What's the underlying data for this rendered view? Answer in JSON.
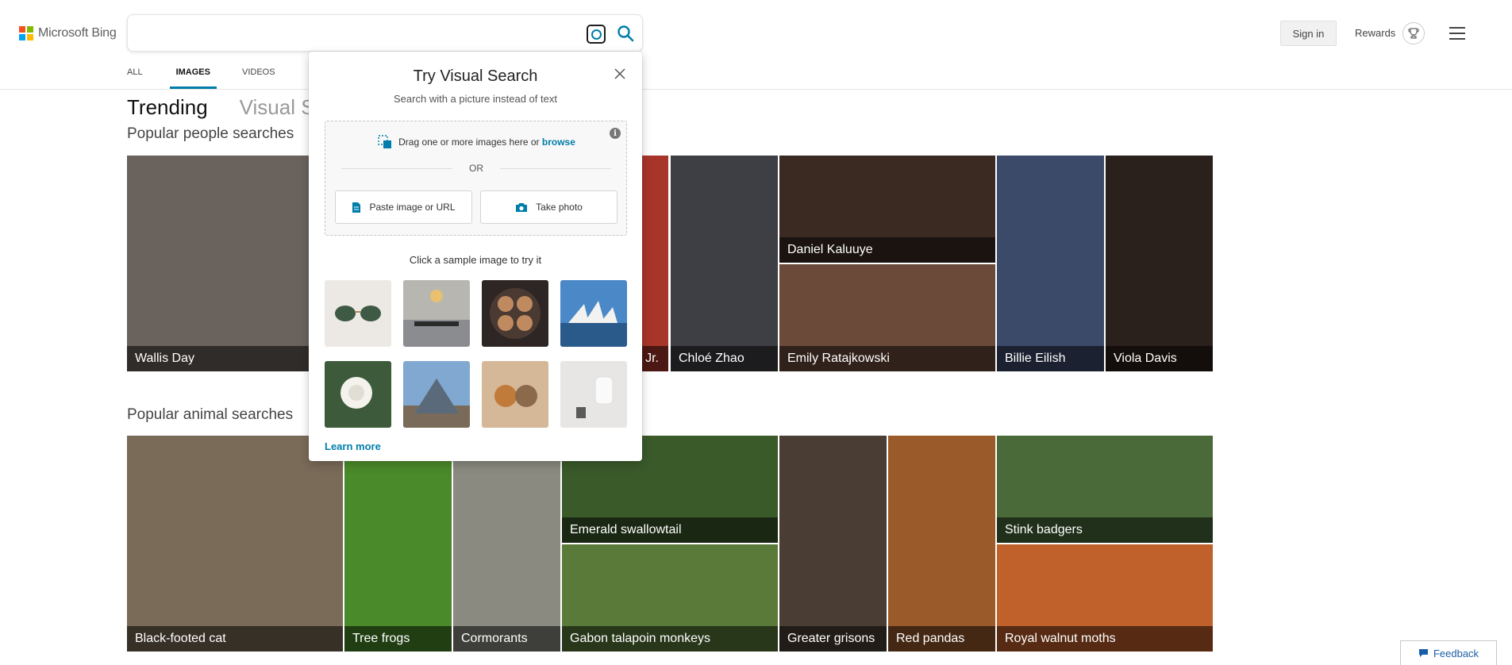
{
  "header": {
    "brand": "Microsoft Bing",
    "search_value": "",
    "signin_label": "Sign in",
    "rewards_label": "Rewards"
  },
  "nav_tabs": [
    "ALL",
    "IMAGES",
    "VIDEOS"
  ],
  "section_tabs": {
    "trending": "Trending",
    "visual": "Visual Se"
  },
  "groups": {
    "people_title": "Popular people searches",
    "animals_title": "Popular animal searches"
  },
  "people": [
    {
      "label": "Wallis Day",
      "color": "#5a5450"
    },
    {
      "label": "Jr.",
      "color": "#a8352a"
    },
    {
      "label": "Chloé Zhao",
      "color": "#3e3f45"
    },
    {
      "label": "Daniel Kaluuye",
      "color": "#3a2a22"
    },
    {
      "label": "Emily Ratajkowski",
      "color": "#6b4a3a"
    },
    {
      "label": "Billie Eilish",
      "color": "#3c4a6a"
    },
    {
      "label": "Viola Davis",
      "color": "#2a201c"
    }
  ],
  "animals": [
    {
      "label": "Black-footed cat",
      "color": "#7a6a58"
    },
    {
      "label": "Tree frogs",
      "color": "#4a8a2a"
    },
    {
      "label": "Cormorants",
      "color": "#8a8a80"
    },
    {
      "label": "Emerald swallowtail",
      "color": "#3a5a2a"
    },
    {
      "label": "Gabon talapoin monkeys",
      "color": "#5a7a3a"
    },
    {
      "label": "Greater grisons",
      "color": "#4a3e34"
    },
    {
      "label": "Red pandas",
      "color": "#9a5a2a"
    },
    {
      "label": "Stink badgers",
      "color": "#4a6a3a"
    },
    {
      "label": "Royal walnut moths",
      "color": "#c0602a"
    }
  ],
  "visual_search": {
    "title": "Try Visual Search",
    "subtitle": "Search with a picture instead of text",
    "drag_text": "Drag one or more images here or",
    "browse_label": "browse",
    "info_glyph": "i",
    "or_label": "OR",
    "paste_label": "Paste image or URL",
    "photo_label": "Take photo",
    "hint": "Click a sample image to try it",
    "learn_more": "Learn more",
    "samples": [
      {
        "icon": "sunglasses-sample",
        "color": "#e8e6e2"
      },
      {
        "icon": "dining-room-sample",
        "color": "#8a8c90"
      },
      {
        "icon": "coffee-cups-sample",
        "color": "#3a2e2a"
      },
      {
        "icon": "opera-house-sample",
        "color": "#3d78b8"
      },
      {
        "icon": "white-rose-sample",
        "color": "#3d5a3a"
      },
      {
        "icon": "louvre-pyramid-sample",
        "color": "#7aa0c8"
      },
      {
        "icon": "puppies-sample",
        "color": "#c8a080"
      },
      {
        "icon": "chair-sample",
        "color": "#e8e6e4"
      }
    ]
  },
  "feedback_label": "Feedback",
  "colors": {
    "accent": "#007daa",
    "ms_red": "#f25022",
    "ms_green": "#7fba00",
    "ms_blue": "#00a4ef",
    "ms_yellow": "#ffb900"
  }
}
